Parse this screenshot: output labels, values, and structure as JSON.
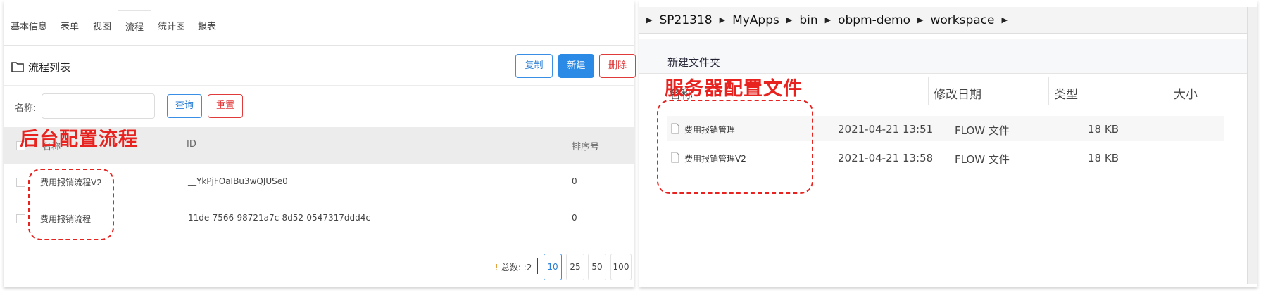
{
  "left": {
    "tabs": [
      "基本信息",
      "表单",
      "视图",
      "流程",
      "统计图",
      "报表"
    ],
    "active_tab": "流程",
    "list_title": "流程列表",
    "buttons": {
      "copy": "复制",
      "new": "新建",
      "delete": "删除"
    },
    "search": {
      "label": "名称:",
      "value": "",
      "query": "查询",
      "reset": "重置"
    },
    "columns": [
      "名称",
      "ID",
      "排序号"
    ],
    "rows": [
      {
        "name": "费用报销流程V2",
        "id": "__YkPjFOaIBu3wQJUSe0",
        "order": "0"
      },
      {
        "name": "费用报销流程",
        "id": "11de-7566-98721a7c-8d52-0547317ddd4c",
        "order": "0"
      }
    ],
    "pager": {
      "total": "总数: :2",
      "warn_glyph": "!",
      "sizes": [
        "10",
        "25",
        "50",
        "100"
      ],
      "active_size": "10"
    },
    "annotation": "后台配置流程"
  },
  "right": {
    "breadcrumb": [
      "SP21318",
      "MyApps",
      "bin",
      "obpm-demo",
      "workspace"
    ],
    "new_folder": "新建文件夹",
    "columns": [
      "名称",
      "修改日期",
      "类型",
      "大小"
    ],
    "files": [
      {
        "name": "费用报销管理",
        "date": "2021-04-21 13:51",
        "type": "FLOW 文件",
        "size": "18 KB"
      },
      {
        "name": "费用报销管理V2",
        "date": "2021-04-21 13:58",
        "type": "FLOW 文件",
        "size": "18 KB"
      }
    ],
    "annotation": "服务器配置文件"
  },
  "colors": {
    "accent": "#2a8ae6",
    "danger": "#e03a3a",
    "annotation": "#e8231f"
  }
}
